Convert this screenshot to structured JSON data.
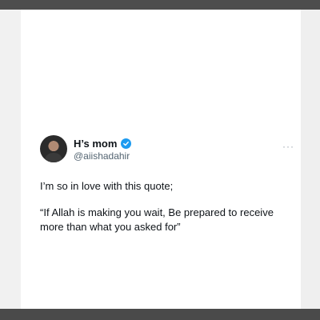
{
  "tweet": {
    "display_name": "H’s mom",
    "handle": "@aiishadahir",
    "more_label": "···",
    "text_line1": "I’m so in love with this quote;",
    "text_line2": "“If Allah is making you wait, Be prepared to receive more than what you asked for”"
  },
  "icons": {
    "verified": "verified-badge-icon",
    "more": "more-options-icon"
  },
  "colors": {
    "verified_blue": "#1d9bf0",
    "text": "#0f1419",
    "secondary_text": "#536471"
  }
}
